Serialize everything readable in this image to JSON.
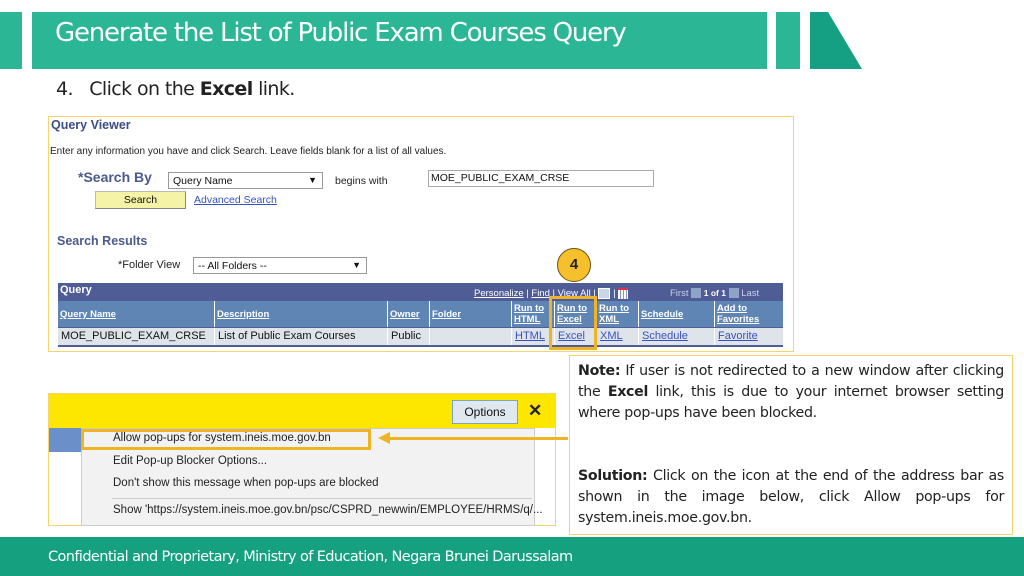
{
  "slide": {
    "title": "Generate the List of Public Exam Courses Query",
    "step": {
      "number": "4.",
      "prefix": "Click on the ",
      "bold": "Excel",
      "suffix": " link."
    },
    "footer": "Confidential and Proprietary, Ministry of Education, Negara Brunei Darussalam",
    "colors": {
      "accent": "#2bb795",
      "footer": "#15a080",
      "highlight": "#f0b325"
    }
  },
  "query_viewer": {
    "title": "Query Viewer",
    "instructions": "Enter any information you have and click Search. Leave fields blank for a list of all values.",
    "search_by_label": "*Search By",
    "search_by_value": "Query Name",
    "operator": "begins with",
    "search_value": "MOE_PUBLIC_EXAM_CRSE",
    "search_button": "Search",
    "advanced_search": "Advanced Search",
    "results_title": "Search Results",
    "folder_view_label": "*Folder View",
    "folder_view_value": "-- All Folders --",
    "grid": {
      "title": "Query",
      "nav": {
        "personalize": "Personalize",
        "find": "Find",
        "view_all": "View All",
        "first": "First",
        "page": "1 of 1",
        "last": "Last"
      },
      "columns": [
        "Query Name",
        "Description",
        "Owner",
        "Folder",
        "Run to HTML",
        "Run to Excel",
        "Run to XML",
        "Schedule",
        "Add to Favorites"
      ],
      "rows": [
        {
          "query_name": "MOE_PUBLIC_EXAM_CRSE",
          "description": "List of Public Exam Courses",
          "owner": "Public",
          "folder": "",
          "html": "HTML",
          "excel": "Excel",
          "xml": "XML",
          "schedule": "Schedule",
          "favorite": "Favorite"
        }
      ]
    },
    "step_badge": "4"
  },
  "popup_blocker": {
    "options_button": "Options",
    "close_glyph": "✕",
    "menu_items": [
      "Allow pop-ups for system.ineis.moe.gov.bn",
      "Edit Pop-up Blocker Options...",
      "Don't show this message when pop-ups are blocked",
      "Show 'https://system.ineis.moe.gov.bn/psc/CSPRD_newwin/EMPLOYEE/HRMS/q/..."
    ]
  },
  "note": {
    "note_label": "Note:",
    "note_text_1": " If user is not redirected to a new window after clicking the ",
    "note_bold": "Excel",
    "note_text_2": " link, this is due to your internet browser setting where pop-ups have been blocked.",
    "solution_label": "Solution:",
    "solution_text": " Click on the icon at the end of the address bar as shown in the image below, click Allow pop-ups for system.ineis.moe.gov.bn."
  }
}
